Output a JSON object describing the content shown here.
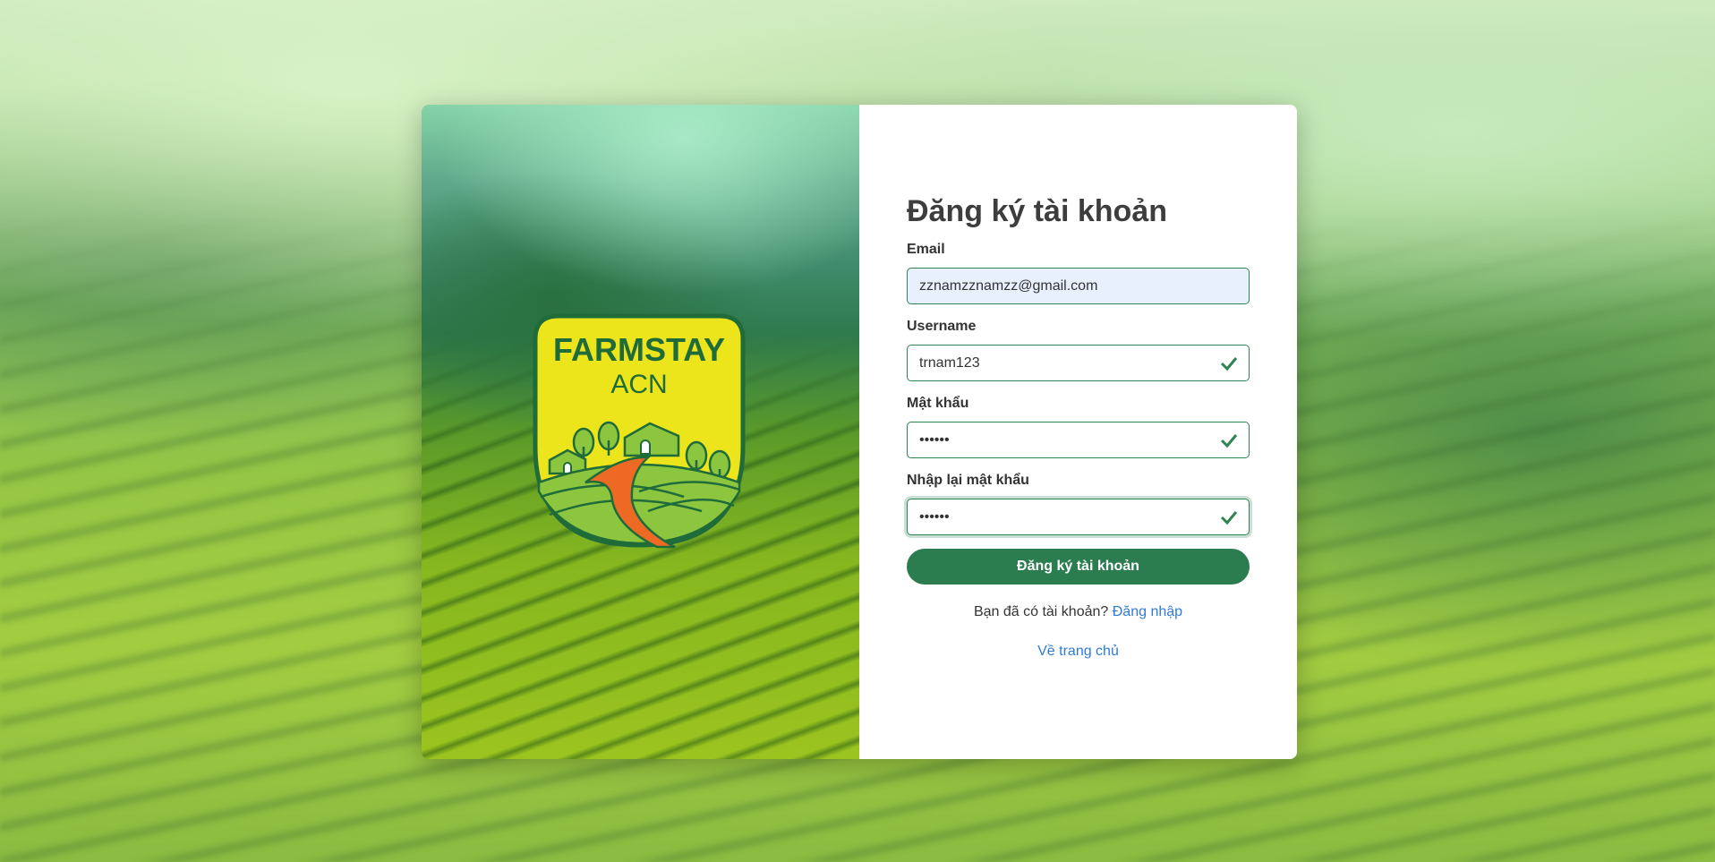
{
  "logo": {
    "line1": "FARMSTAY",
    "line2": "ACN"
  },
  "form": {
    "title": "Đăng ký tài khoản",
    "email": {
      "label": "Email",
      "value": "zznamzznamzz@gmail.com"
    },
    "username": {
      "label": "Username",
      "value": "trnam123"
    },
    "password": {
      "label": "Mật khẩu",
      "value": "123456"
    },
    "confirm": {
      "label": "Nhập lại mật khẩu",
      "value": "123456"
    },
    "submit_label": "Đăng ký tài khoản",
    "have_account_text": "Bạn đã có tài khoản?",
    "login_link": "Đăng nhập",
    "home_link": "Về trang chủ"
  },
  "colors": {
    "primary": "#2b7d4f",
    "link": "#2f7bd8",
    "check": "#2e8452",
    "logo_yellow": "#ece51c",
    "logo_green": "#1f6b3a"
  },
  "icons": [
    "check-icon"
  ]
}
